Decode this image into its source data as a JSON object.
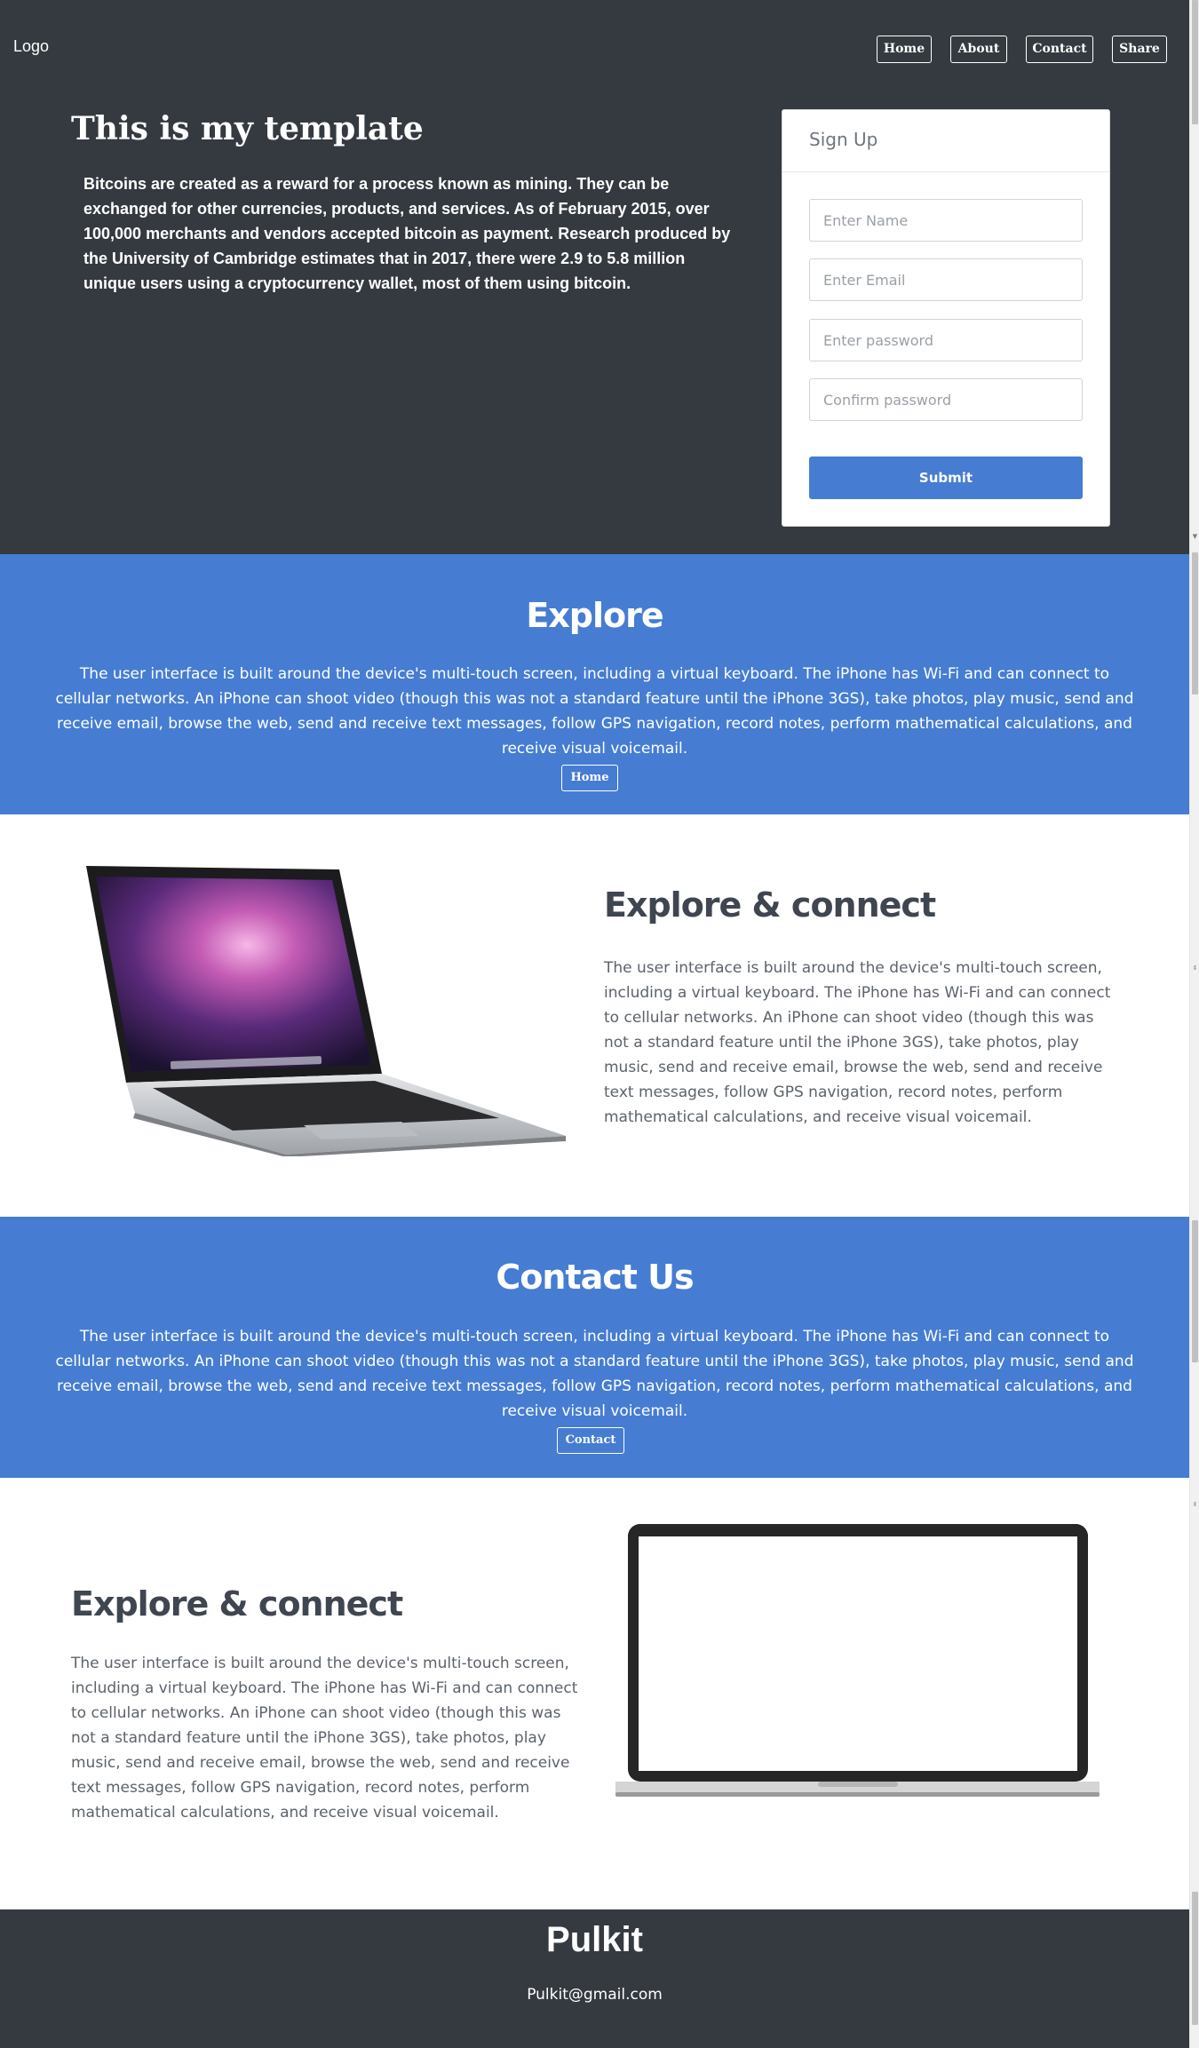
{
  "header": {
    "logo": "Logo",
    "nav": [
      "Home",
      "About",
      "Contact",
      "Share"
    ]
  },
  "hero": {
    "title": "This is my template",
    "text": "Bitcoins are created as a reward for a process known as mining. They can be exchanged for other currencies, products, and services. As of February 2015, over 100,000 merchants and vendors accepted bitcoin as payment. Research produced by the University of Cambridge estimates that in 2017, there were 2.9 to 5.8 million unique users using a cryptocurrency wallet, most of them using bitcoin."
  },
  "signup": {
    "title": "Sign Up",
    "name_placeholder": "Enter Name",
    "email_placeholder": "Enter Email",
    "password_placeholder": "Enter password",
    "confirm_placeholder": "Confirm password",
    "submit": "Submit"
  },
  "explore": {
    "title": "Explore",
    "text": "The user interface is built around the device's multi-touch screen, including a virtual keyboard. The iPhone has Wi-Fi and can connect to cellular networks. An iPhone can shoot video (though this was not a standard feature until the iPhone 3GS), take photos, play music, send and receive email, browse the web, send and receive text messages, follow GPS navigation, record notes, perform mathematical calculations, and receive visual voicemail.",
    "button": "Home"
  },
  "feature1": {
    "title": "Explore & connect",
    "text": "The user interface is built around the device's multi-touch screen, including a virtual keyboard. The iPhone has Wi-Fi and can connect to cellular networks. An iPhone can shoot video (though this was not a standard feature until the iPhone 3GS), take photos, play music, send and receive email, browse the web, send and receive text messages, follow GPS navigation, record notes, perform mathematical calculations, and receive visual voicemail."
  },
  "contact": {
    "title": "Contact Us",
    "text": "The user interface is built around the device's multi-touch screen, including a virtual keyboard. The iPhone has Wi-Fi and can connect to cellular networks. An iPhone can shoot video (though this was not a standard feature until the iPhone 3GS), take photos, play music, send and receive email, browse the web, send and receive text messages, follow GPS navigation, record notes, perform mathematical calculations, and receive visual voicemail.",
    "button": "Contact"
  },
  "feature2": {
    "title": "Explore & connect",
    "text": "The user interface is built around the device's multi-touch screen, including a virtual keyboard. The iPhone has Wi-Fi and can connect to cellular networks. An iPhone can shoot video (though this was not a standard feature until the iPhone 3GS), take photos, play music, send and receive email, browse the web, send and receive text messages, follow GPS navigation, record notes, perform mathematical calculations, and receive visual voicemail."
  },
  "footer": {
    "name": "Pulkit",
    "email": "Pulkit@gmail.com"
  },
  "colors": {
    "dark": "#343a40",
    "accent": "#467dd2",
    "text_gray": "#5c636b"
  },
  "icons": {
    "laptop_photo": "macbook-pro-image",
    "laptop_outline": "laptop-outline-image"
  }
}
